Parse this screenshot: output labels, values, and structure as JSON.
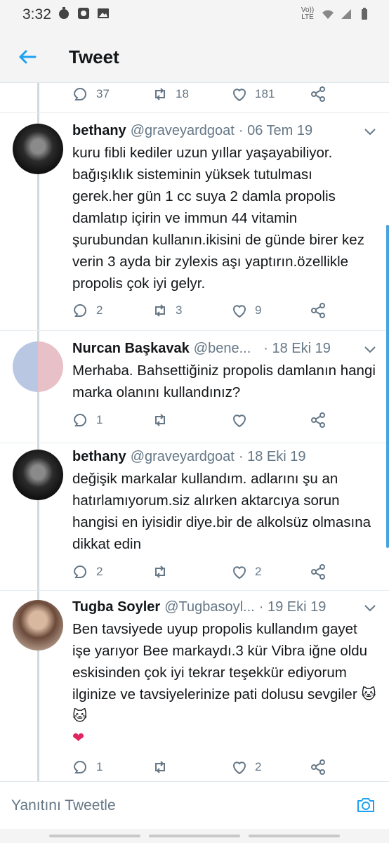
{
  "status": {
    "time": "3:32",
    "network": "Vo)) LTE"
  },
  "header": {
    "title": "Tweet"
  },
  "top_actions": {
    "replies": "37",
    "retweets": "18",
    "likes": "181"
  },
  "tweets": [
    {
      "name": "bethany",
      "handle": "@graveyardgoat",
      "date": "· 06 Tem 19",
      "text": "kuru fibli kediler uzun yıllar yaşayabiliyor. bağışıklık sisteminin yüksek tutulması gerek.her gün 1 cc suya 2 damla propolis damlatıp içirin ve immun 44 vitamin şurubundan kullanın.ikisini de günde birer kez verin 3 ayda bir zylexis aşı yaptırın.özellikle propolis çok iyi gelyr.",
      "replies": "2",
      "retweets": "3",
      "likes": "9"
    },
    {
      "name": "Nurcan Başkavak",
      "handle": "@bene...",
      "date": "· 18 Eki 19",
      "text": "Merhaba. Bahsettiğiniz propolis damlanın hangi marka olanını kullandınız?",
      "replies": "1",
      "retweets": "",
      "likes": ""
    },
    {
      "name": "bethany",
      "handle": "@graveyardgoat",
      "date": "· 18 Eki 19",
      "text": "değişik markalar kullandım. adlarını şu an hatırlamıyorum.siz alırken aktarcıya sorun hangisi en iyisidir diye.bir de alkolsüz olmasına dikkat edin",
      "replies": "2",
      "retweets": "",
      "likes": "2"
    },
    {
      "name": "Tugba Soyler",
      "handle": "@Tugbasoyl...",
      "date": "· 19 Eki 19",
      "text": "Ben tavsiyede uyup propolis kullandım gayet işe yarıyor Bee markaydı.3  kür Vibra iğne oldu eskisinden çok iyi tekrar teşekkür ediyorum ilginize ve tavsiyelerinize pati dolusu sevgiler 🐱🐱",
      "text_heart": "❤",
      "replies": "1",
      "retweets": "",
      "likes": "2"
    }
  ],
  "reply_bar": {
    "placeholder": "Yanıtını Tweetle"
  },
  "colors": {
    "accent": "#1da1f2",
    "muted": "#657786",
    "text": "#14171a"
  }
}
